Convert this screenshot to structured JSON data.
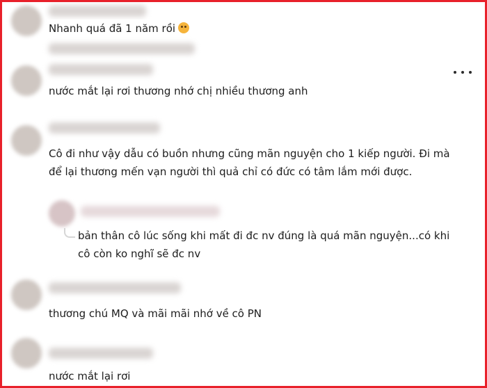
{
  "comments": [
    {
      "text": "Nhanh quá đã 1 năm rồi"
    },
    {
      "text": "nước mắt lại rơi thương nhớ chị nhiều thương anh"
    },
    {
      "line1": "Cô đi như vậy dẫu có buồn nhưng cũng mãn nguyện cho 1 kiếp người. Đi mà",
      "line2": "để lại thương mến vạn người thì quả chỉ có đức có tâm lắm mới được."
    },
    {
      "line1": "bản thân cô lúc sống khi mất đi đc nv đúng là quá mãn nguyện...có khi",
      "line2": "cô còn ko nghĩ sẽ đc nv"
    },
    {
      "text": "thương chú MQ và mãi mãi nhớ về cô PN"
    },
    {
      "text": "nước mắt lại rơi"
    }
  ],
  "icons": {
    "emoji": "pleading-face-emoji",
    "more": "more-options-icon"
  }
}
